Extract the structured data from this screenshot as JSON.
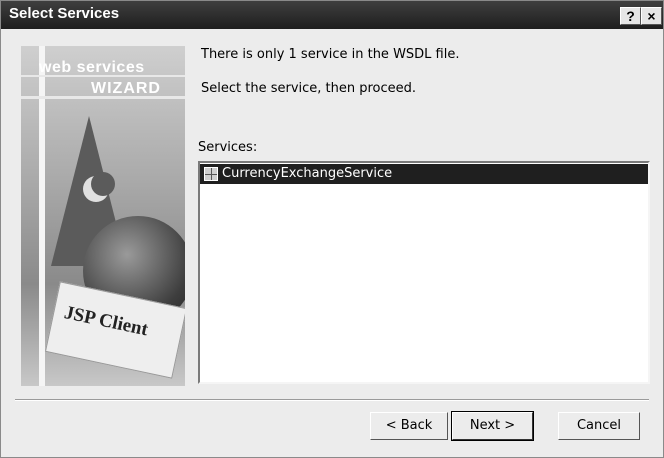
{
  "window": {
    "title": "Select Services",
    "help_label": "?",
    "close_label": "×"
  },
  "banner": {
    "line1": "web services",
    "line2": "WIZARD",
    "card": "JSP Client"
  },
  "content": {
    "message1": "There is only 1 service in the WSDL file.",
    "message2": "Select the service, then proceed.",
    "services_label": "Services:",
    "services": [
      {
        "label": "CurrencyExchangeService",
        "selected": true,
        "icon": "service-icon"
      }
    ]
  },
  "buttons": {
    "back": "< Back",
    "next": "Next >",
    "cancel": "Cancel"
  },
  "colors": {
    "title_bar": "#2a2a2a",
    "selection": "#1f1f1f",
    "dialog_bg": "#ececec"
  }
}
